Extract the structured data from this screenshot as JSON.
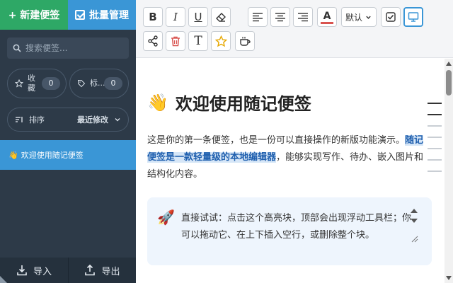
{
  "sidebar": {
    "new_button": "+ 新建便签",
    "batch_button": "批量管理",
    "search_placeholder": "搜索便签...",
    "favorites": {
      "label": "收藏",
      "count": "0"
    },
    "tags": {
      "label": "标...",
      "count": "0"
    },
    "sort": {
      "label": "排序",
      "value": "最近修改"
    },
    "notes": [
      {
        "emoji": "👋",
        "title": "欢迎使用随记便签"
      }
    ],
    "import_label": "导入",
    "export_label": "导出"
  },
  "toolbar": {
    "bold": "B",
    "italic": "I",
    "underline": "U",
    "font_color_icon": "A",
    "font_size_select": "默认",
    "text_icon": "T"
  },
  "editor": {
    "title_emoji": "👋",
    "title": "欢迎使用随记便签",
    "para_part1": "这是你的第一条便签，也是一份可以直接操作的新版功能演示。",
    "para_highlight": "随记便签是一款轻量级的本地编辑器",
    "para_part2": "，能够实现写作、待办、嵌入图片和结构化内容。",
    "callout_emoji": "🚀",
    "callout_text": "直接试试：点击这个高亮块，顶部会出现浮动工具栏；你可以拖动它、在上下插入空行，或删除整个块。"
  },
  "colors": {
    "sidebar_bg": "#2d3a48",
    "new_button": "#2ea866",
    "accent_blue": "#3a96d6",
    "delete_red": "#d9534f",
    "star_yellow": "#e6a700"
  }
}
